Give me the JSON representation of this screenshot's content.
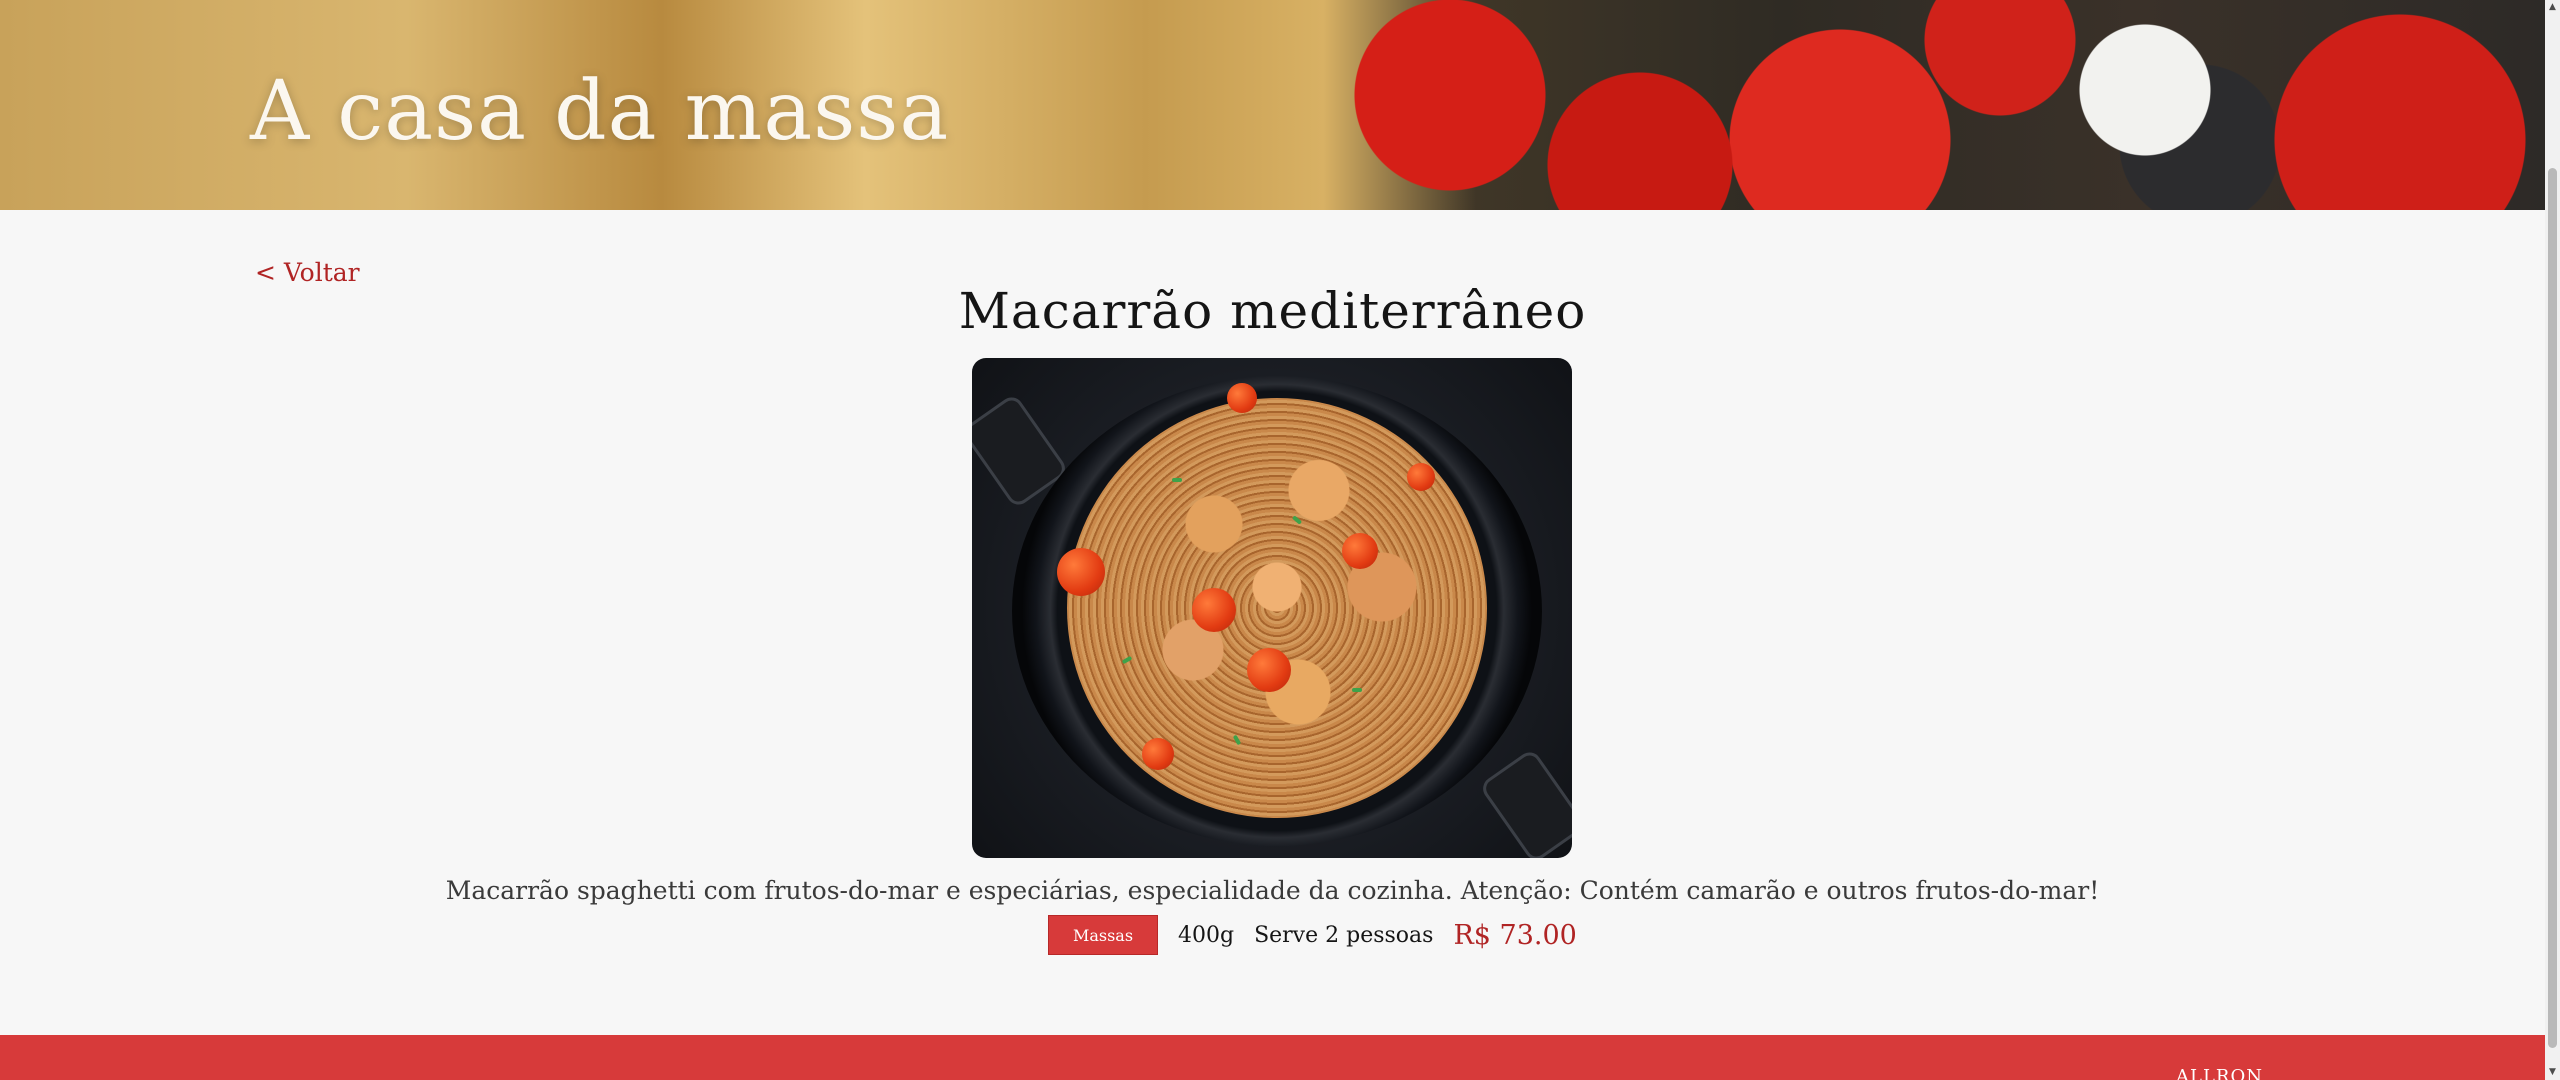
{
  "header": {
    "title": "A casa da massa"
  },
  "nav": {
    "back_label": "< Voltar"
  },
  "dish": {
    "title": "Macarrão mediterrâneo",
    "description": "Macarrão spaghetti com frutos-do-mar e especiárias, especialidade da cozinha. Atenção: Contém camarão e outros frutos-do-mar!",
    "category": "Massas",
    "weight": "400g",
    "serves": "Serve 2 pessoas",
    "price": "R$ 73.00"
  },
  "footer": {
    "text": "ALLRON"
  },
  "scrollbar": {
    "up_icon": "▲",
    "down_icon": "▼"
  },
  "colors": {
    "accent": "#d73a3a",
    "price": "#b02424",
    "background": "#f7f7f7"
  }
}
